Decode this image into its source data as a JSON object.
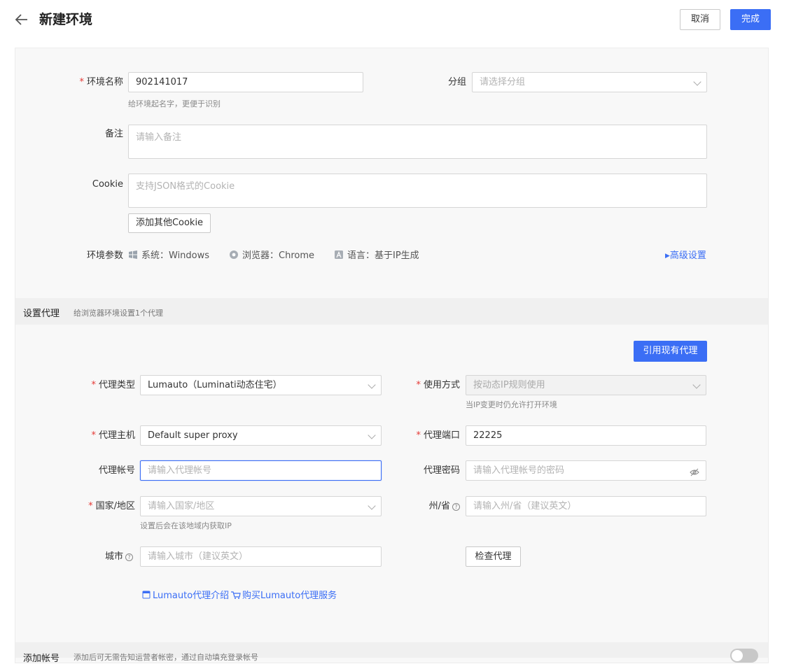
{
  "header": {
    "title": "新建环境",
    "cancel_label": "取消",
    "done_label": "完成"
  },
  "basic": {
    "name_label": "环境名称",
    "name_value": "902141017",
    "name_hint": "给环境起名字，更便于识别",
    "group_label": "分组",
    "group_placeholder": "请选择分组",
    "note_label": "备注",
    "note_placeholder": "请输入备注",
    "cookie_label": "Cookie",
    "cookie_placeholder": "支持JSON格式的Cookie",
    "add_cookie_label": "添加其他Cookie",
    "params_label": "环境参数",
    "param_os": "系统：Windows",
    "param_browser": "浏览器：Chrome",
    "param_lang": "语言：基于IP生成",
    "advanced_label": "高级设置"
  },
  "proxy": {
    "section_title": "设置代理",
    "section_hint": "给浏览器环境设置1个代理",
    "use_existing_label": "引用现有代理",
    "type_label": "代理类型",
    "type_value": "Lumauto（Luminati动态住宅）",
    "mode_label": "使用方式",
    "mode_value": "按动态IP规则使用",
    "mode_hint": "当IP变更时仍允许打开环境",
    "host_label": "代理主机",
    "host_value": "Default super proxy",
    "port_label": "代理端口",
    "port_value": "22225",
    "account_label": "代理帐号",
    "account_placeholder": "请输入代理帐号",
    "password_label": "代理密码",
    "password_placeholder": "请输入代理帐号的密码",
    "country_label": "国家/地区",
    "country_placeholder": "请输入国家/地区",
    "country_hint": "设置后会在该地域内获取IP",
    "state_label": "州/省",
    "state_placeholder": "请输入州/省（建议英文）",
    "city_label": "城市",
    "city_placeholder": "请输入城市（建议英文）",
    "check_label": "检查代理",
    "intro_link": "Lumauto代理介绍",
    "buy_link": "购买Lumauto代理服务"
  },
  "account": {
    "section_title": "添加帐号",
    "section_hint": "添加后可无需告知运营者帐密，通过自动填充登录帐号"
  },
  "colors": {
    "primary": "#3b6ef5",
    "required": "#e53935"
  }
}
